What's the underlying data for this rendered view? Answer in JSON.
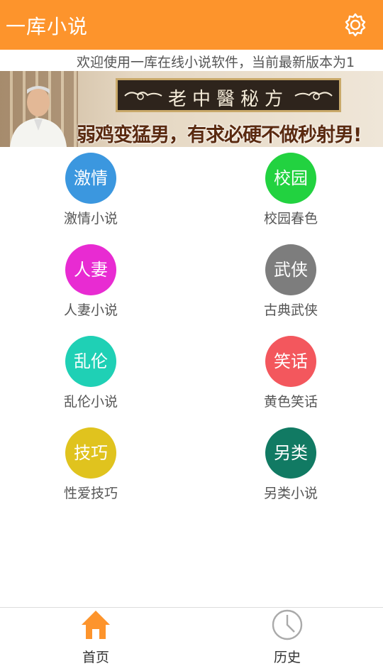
{
  "header": {
    "title": "一库小说",
    "settings_icon": "gear-icon"
  },
  "marquee": {
    "text": "欢迎使用一库在线小说软件，当前最新版本为1"
  },
  "banner": {
    "sign": "老中醫秘方",
    "slogan": "弱鸡变猛男，有求必硬不做秒射男!"
  },
  "categories": [
    {
      "icon_text": "激情",
      "label": "激情小说",
      "color": "#3b97df"
    },
    {
      "icon_text": "校园",
      "label": "校园春色",
      "color": "#22d240"
    },
    {
      "icon_text": "人妻",
      "label": "人妻小说",
      "color": "#e82bd2"
    },
    {
      "icon_text": "武侠",
      "label": "古典武侠",
      "color": "#7d7d7d"
    },
    {
      "icon_text": "乱伦",
      "label": "乱伦小说",
      "color": "#1fd0b5"
    },
    {
      "icon_text": "笑话",
      "label": "黄色笑话",
      "color": "#f3575d"
    },
    {
      "icon_text": "技巧",
      "label": "性爱技巧",
      "color": "#e0c31e"
    },
    {
      "icon_text": "另类",
      "label": "另类小说",
      "color": "#117a63"
    }
  ],
  "bottom_nav": [
    {
      "label": "首页",
      "icon": "home-icon",
      "color": "#fd942c"
    },
    {
      "label": "历史",
      "icon": "clock-icon",
      "color": "#aaaaaa"
    }
  ]
}
